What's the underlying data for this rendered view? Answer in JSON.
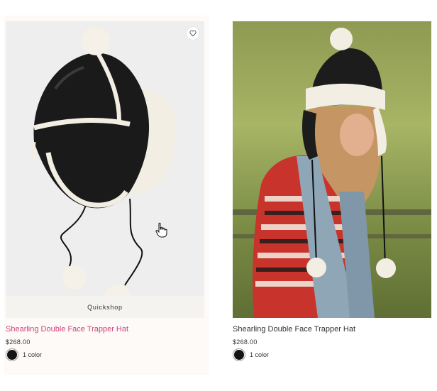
{
  "products": [
    {
      "title": "Shearling Double Face Trapper Hat",
      "price": "$268.00",
      "colors_label": "1 color",
      "swatch_color": "#141414",
      "quickshop_label": "Quickshop",
      "title_color": "#d1417c",
      "wishlist_icon": "heart-icon"
    },
    {
      "title": "Shearling Double Face Trapper Hat",
      "price": "$268.00",
      "colors_label": "1 color",
      "swatch_color": "#141414",
      "title_color": "#333333"
    }
  ],
  "cursor_icon": "hand-pointer-icon"
}
